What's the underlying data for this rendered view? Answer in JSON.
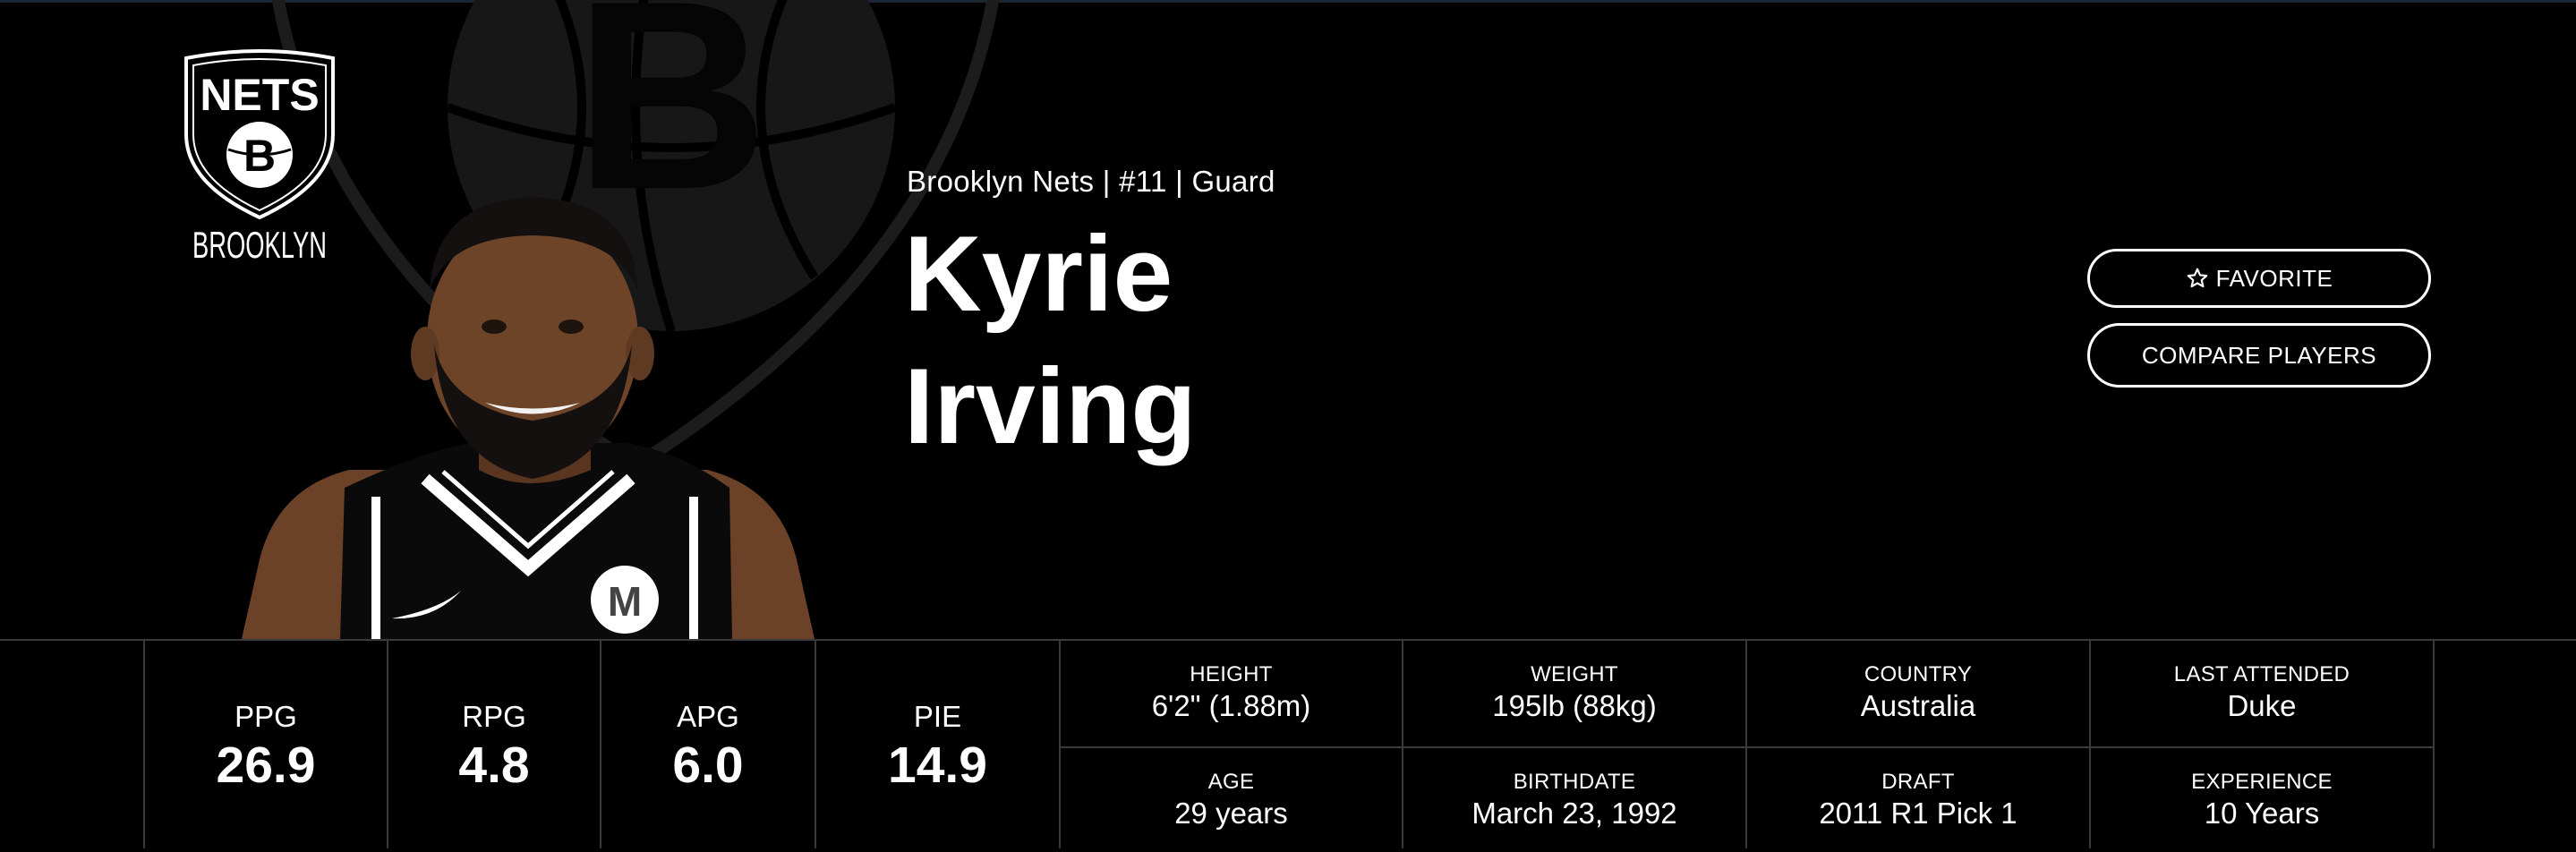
{
  "team": {
    "logo_text_top": "NETS",
    "logo_letter": "B",
    "logo_text_bottom": "BROOKLYN",
    "info_line": "Brooklyn Nets | #11 | Guard"
  },
  "player": {
    "first_name": "Kyrie",
    "last_name": "Irving",
    "jersey_badge": "M"
  },
  "actions": {
    "favorite_label": "FAVORITE",
    "compare_label": "COMPARE PLAYERS"
  },
  "stats": [
    {
      "label": "PPG",
      "value": "26.9"
    },
    {
      "label": "RPG",
      "value": "4.8"
    },
    {
      "label": "APG",
      "value": "6.0"
    },
    {
      "label": "PIE",
      "value": "14.9"
    }
  ],
  "bio": {
    "height": {
      "label": "HEIGHT",
      "value": "6'2\" (1.88m)"
    },
    "weight": {
      "label": "WEIGHT",
      "value": "195lb (88kg)"
    },
    "country": {
      "label": "COUNTRY",
      "value": "Australia"
    },
    "last_attended": {
      "label": "LAST ATTENDED",
      "value": "Duke"
    },
    "age": {
      "label": "AGE",
      "value": "29 years"
    },
    "birthdate": {
      "label": "BIRTHDATE",
      "value": "March 23, 1992"
    },
    "draft": {
      "label": "DRAFT",
      "value": "2011 R1 Pick 1"
    },
    "experience": {
      "label": "EXPERIENCE",
      "value": "10 Years"
    }
  },
  "colors": {
    "background": "#000000",
    "divider": "#3a3a3a",
    "watermark": "#1c1c1c",
    "accent": "#ffffff"
  }
}
